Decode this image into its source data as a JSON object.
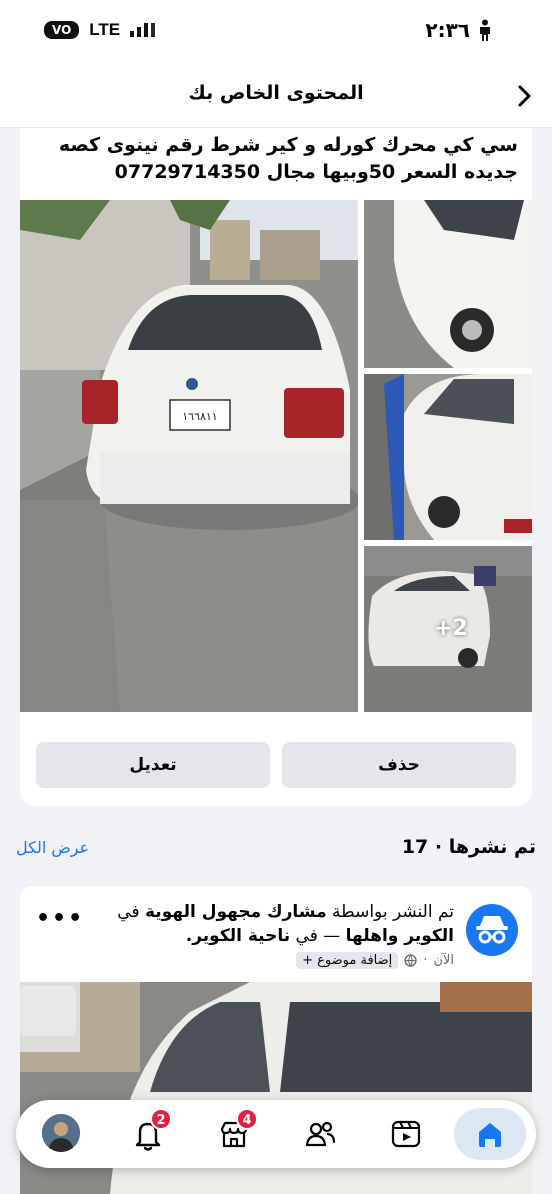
{
  "status_bar": {
    "carrier_badge": "VO",
    "network": "LTE",
    "time": "٢:٣٦"
  },
  "header": {
    "title": "المحتوى الخاص بك",
    "back_icon": "chevron-right-icon"
  },
  "post": {
    "text_line1": "سي كي محرك كورله و كير شرط رقم نينوى كصه",
    "text_line2": "جديده السعر 50وبيها مجال 07729714350",
    "more_photos": "+2",
    "plate": "١٦٦٨١١",
    "edit_label": "تعديل",
    "delete_label": "حذف"
  },
  "published": {
    "count_label": "تم نشرها",
    "count": "17",
    "see_all": "عرض الكل"
  },
  "post2": {
    "prefix": "تم النشر بواسطة",
    "author": "مشارك مجهول الهوية",
    "in_word": "في",
    "group": "الكوير واهلها",
    "dash": "—",
    "in_word2": "في",
    "location": "ناحية الكوير.",
    "time": "الآن",
    "add_topic": "إضافة موضوع +",
    "more_icon": "more-horizontal-icon"
  },
  "tab_bar": {
    "notifications_badge": "2",
    "marketplace_badge": "4",
    "icons": [
      "profile-avatar",
      "bell-icon",
      "marketplace-icon",
      "friends-icon",
      "video-icon",
      "home-icon"
    ]
  },
  "colors": {
    "accent": "#1877f2",
    "badge": "#e41e3f",
    "background": "#f0f2f5"
  }
}
